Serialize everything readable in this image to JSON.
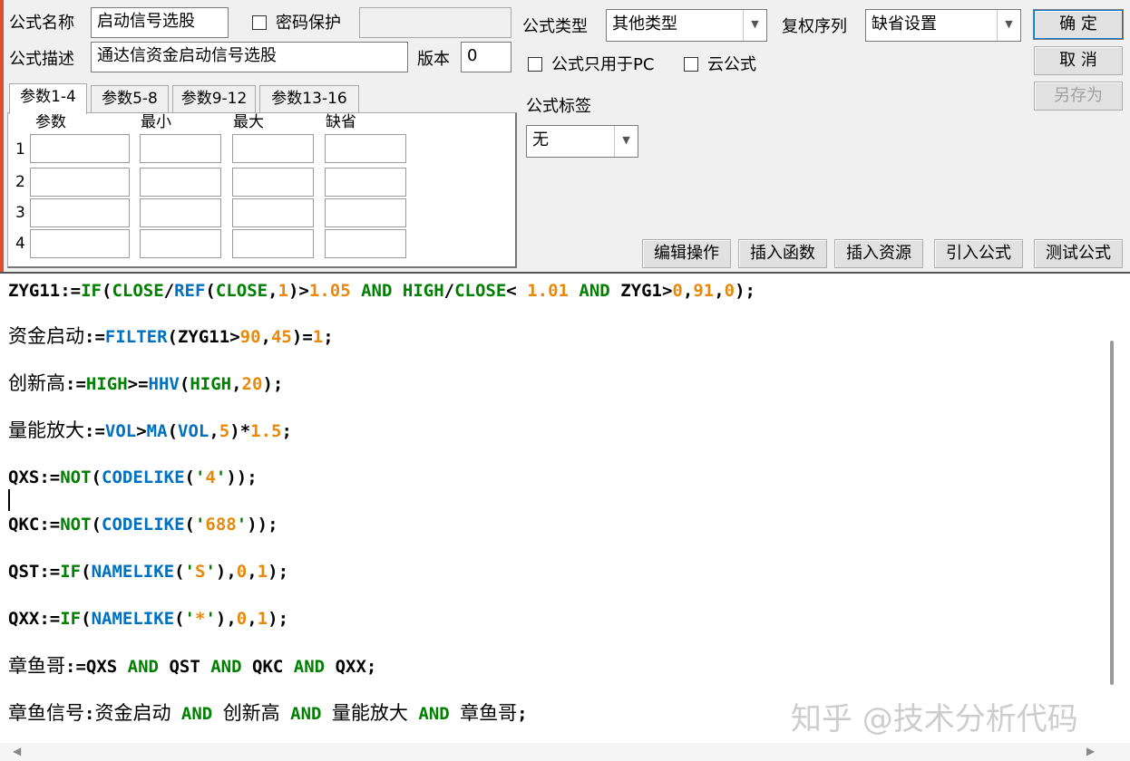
{
  "header": {
    "name_label": "公式名称",
    "name_value": "启动信号选股",
    "password_label": "密码保护",
    "password_value": "",
    "desc_label": "公式描述",
    "desc_value": "通达信资金启动信号选股",
    "version_label": "版本",
    "version_value": "0",
    "type_label": "公式类型",
    "type_value": "其他类型",
    "restore_label": "复权序列",
    "restore_value": "缺省设置",
    "pc_only_label": "公式只用于PC",
    "cloud_label": "云公式",
    "tag_label": "公式标签",
    "tag_value": "无"
  },
  "buttons": {
    "ok": "确  定",
    "cancel": "取  消",
    "save_as": "另存为",
    "edit_ops": "编辑操作",
    "insert_func": "插入函数",
    "insert_res": "插入资源",
    "import_formula": "引入公式",
    "test_formula": "测试公式"
  },
  "tabs": [
    "参数1-4",
    "参数5-8",
    "参数9-12",
    "参数13-16"
  ],
  "params": {
    "headers": [
      "参数",
      "最小",
      "最大",
      "缺省"
    ],
    "rows": [
      "1",
      "2",
      "3",
      "4"
    ]
  },
  "code_lines": [
    "ZYG11:=IF(CLOSE/REF(CLOSE,1)>1.05 AND HIGH/CLOSE< 1.01 AND ZYG1>0,91,0);",
    "资金启动:=FILTER(ZYG11>90,45)=1;",
    "创新高:=HIGH>=HHV(HIGH,20);",
    "量能放大:=VOL>MA(VOL,5)*1.5;",
    "QXS:=NOT(CODELIKE('4'));",
    "QKC:=NOT(CODELIKE('688'));",
    "QST:=IF(NAMELIKE('S'),0,1);",
    "QXX:=IF(NAMELIKE('*'),0,1);",
    "章鱼哥:=QXS AND QST AND QKC AND QXX;",
    "章鱼信号:资金启动 AND 创新高 AND 量能放大 AND 章鱼哥;"
  ],
  "colors": {
    "keyword": "#008000",
    "function": "#0070c0",
    "number": "#e8890c",
    "plain": "#000000"
  },
  "watermark": "知乎 @技术分析代码"
}
